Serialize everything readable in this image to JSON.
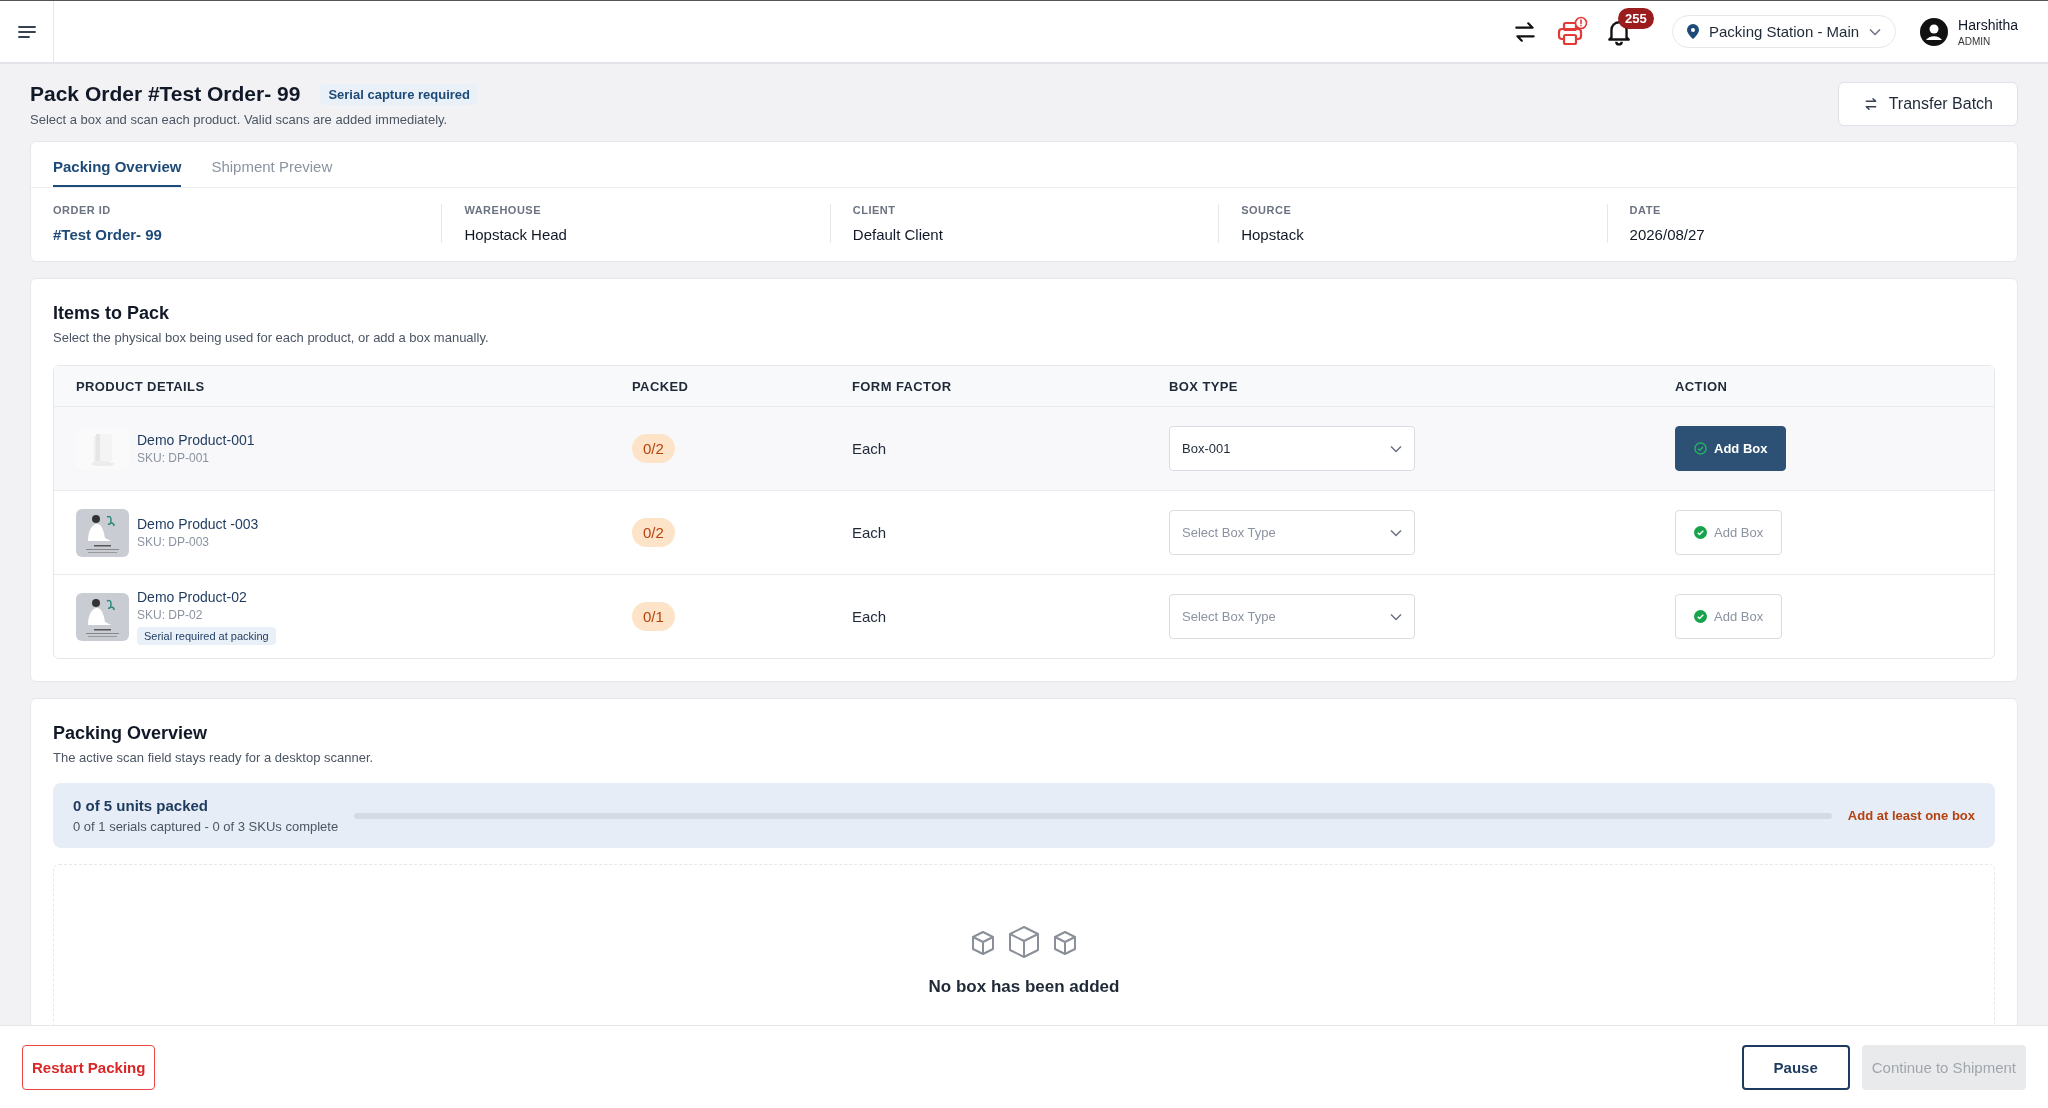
{
  "header": {
    "notification_count": "255",
    "station": "Packing Station - Main",
    "user": {
      "name": "Harshitha",
      "role": "ADMIN"
    }
  },
  "page": {
    "title": "Pack Order #Test Order- 99",
    "badge": "Serial capture required",
    "subtitle": "Select a box and scan each product. Valid scans are added immediately.",
    "transfer_button": "Transfer Batch"
  },
  "tabs": [
    {
      "label": "Packing Overview",
      "selected": true
    },
    {
      "label": "Shipment Preview",
      "selected": false
    }
  ],
  "order_info": [
    {
      "label": "ORDER ID",
      "value": "#Test Order- 99",
      "kind": "link"
    },
    {
      "label": "WAREHOUSE",
      "value": "Hopstack Head",
      "kind": "plain"
    },
    {
      "label": "CLIENT",
      "value": "Default Client",
      "kind": "plain"
    },
    {
      "label": "SOURCE",
      "value": "Hopstack",
      "kind": "plain"
    },
    {
      "label": "DATE",
      "value": "2026/08/27",
      "kind": "plain"
    }
  ],
  "items": {
    "title": "Items to Pack",
    "subtitle": "Select the physical box being used for each product, or add a box manually.",
    "columns": [
      "PRODUCT DETAILS",
      "PACKED",
      "FORM FACTOR",
      "BOX TYPE",
      "ACTION"
    ],
    "rows": [
      {
        "name": "Demo Product-001",
        "sku": "SKU: DP-001",
        "packed": "0/2",
        "form_factor": "Each",
        "box_value": "Box-001",
        "action": "Add Box",
        "highlighted": true
      },
      {
        "name": "Demo Product -003",
        "sku": "SKU: DP-003",
        "packed": "0/2",
        "form_factor": "Each",
        "box_placeholder": "Select Box Type",
        "action": "Add Box",
        "highlighted": false
      },
      {
        "name": "Demo Product-02",
        "sku": "SKU: DP-02",
        "tag": "Serial required at packing",
        "packed": "0/1",
        "form_factor": "Each",
        "box_placeholder": "Select Box Type",
        "action": "Add Box",
        "highlighted": false
      }
    ]
  },
  "overview": {
    "title": "Packing Overview",
    "subtitle": "The active scan field stays ready for a desktop scanner.",
    "units": "0 of 5 units packed",
    "details": "0 of 1 serials captured - 0 of 3 SKUs complete",
    "level": 0,
    "hint": "Add at least one box",
    "empty_title": "No box has been added"
  },
  "footer": {
    "restart": "Restart Packing",
    "pause": "Pause",
    "continue": "Continue to Shipment",
    "continue_disabled": true
  }
}
